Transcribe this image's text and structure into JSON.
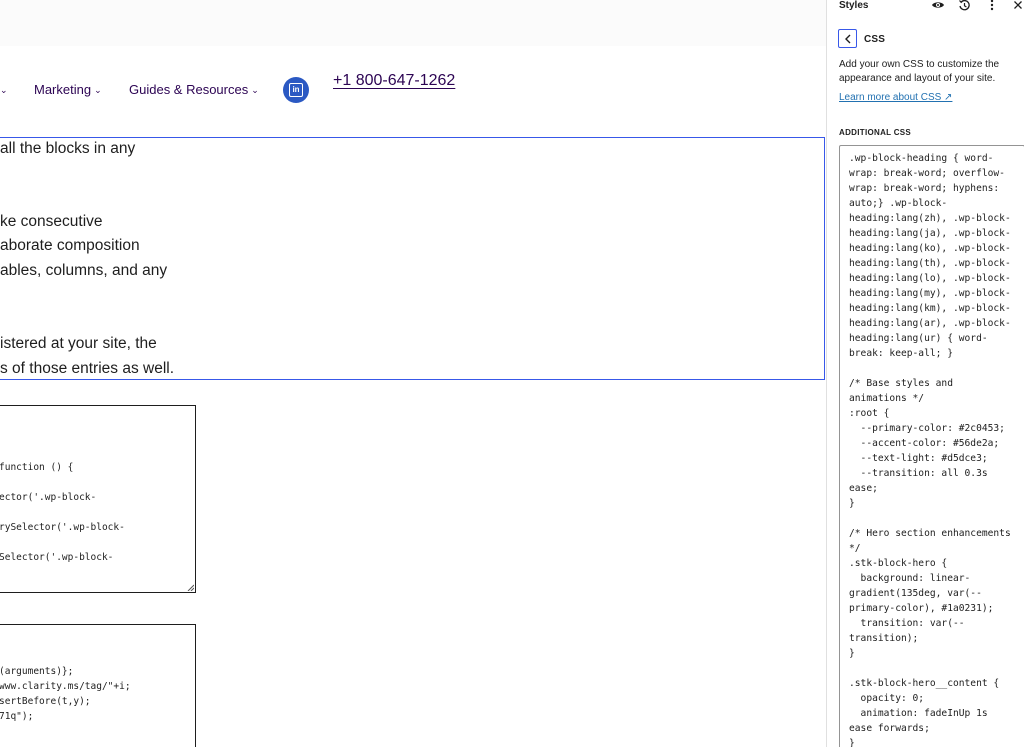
{
  "header": {
    "nav": [
      {
        "label": "Marketing"
      },
      {
        "label": "Guides & Resources"
      }
    ],
    "phone": "+1 800-647-1262"
  },
  "content": {
    "paragraph_lines": [
      "all the blocks in any",
      "ke consecutive",
      "aborate composition",
      "ables, columns, and any",
      "istered at your site, the",
      "s of those entries as well."
    ],
    "code_block_1": [
      "function () {",
      "ector('.wp-block-",
      "rySelector('.wp-block-",
      "Selector('.wp-block-"
    ],
    "code_block_2": [
      "(arguments)};",
      "www.clarity.ms/tag/\"+i;",
      "sertBefore(t,y);",
      "71q\");"
    ]
  },
  "sidebar": {
    "title": "Styles",
    "heading": "CSS",
    "description": "Add your own CSS to customize the appearance and layout of your site.",
    "learn_more": "Learn more about CSS ↗",
    "section_label": "ADDITIONAL CSS",
    "css_lines": [
      ".wp-block-heading { word-",
      "wrap: break-word; overflow-",
      "wrap: break-word; hyphens:",
      "auto;} .wp-block-",
      "heading:lang(zh), .wp-block-",
      "heading:lang(ja), .wp-block-",
      "heading:lang(ko), .wp-block-",
      "heading:lang(th), .wp-block-",
      "heading:lang(lo), .wp-block-",
      "heading:lang(my), .wp-block-",
      "heading:lang(km), .wp-block-",
      "heading:lang(ar), .wp-block-",
      "heading:lang(ur) { word-",
      "break: keep-all; }",
      "",
      "/* Base styles and",
      "animations */",
      ":root {",
      "  --primary-color: #2c0453;",
      "  --accent-color: #56de2a;",
      "  --text-light: #d5dce3;",
      "  --transition: all 0.3s",
      "ease;",
      "}",
      "",
      "/* Hero section enhancements",
      "*/",
      ".stk-block-hero {",
      "  background: linear-",
      "gradient(135deg, var(--",
      "primary-color), #1a0231);",
      "  transition: var(--",
      "transition);",
      "}",
      "",
      ".stk-block-hero__content {",
      "  opacity: 0;",
      "  animation: fadeInUp 1s",
      "ease forwards;",
      "}"
    ]
  },
  "colors": {
    "brand_purple": "#2c0453",
    "linkedin_blue": "#2b59c3",
    "selection_blue": "#3858e9",
    "link_blue": "#2271b1"
  },
  "icons": {
    "nav_dropdown": "chevron-down-icon",
    "social": "linkedin-icon",
    "sidebar_actions": [
      "eye-icon",
      "revisions-icon",
      "more-options-icon",
      "close-icon"
    ],
    "back": "chevron-left-icon"
  }
}
